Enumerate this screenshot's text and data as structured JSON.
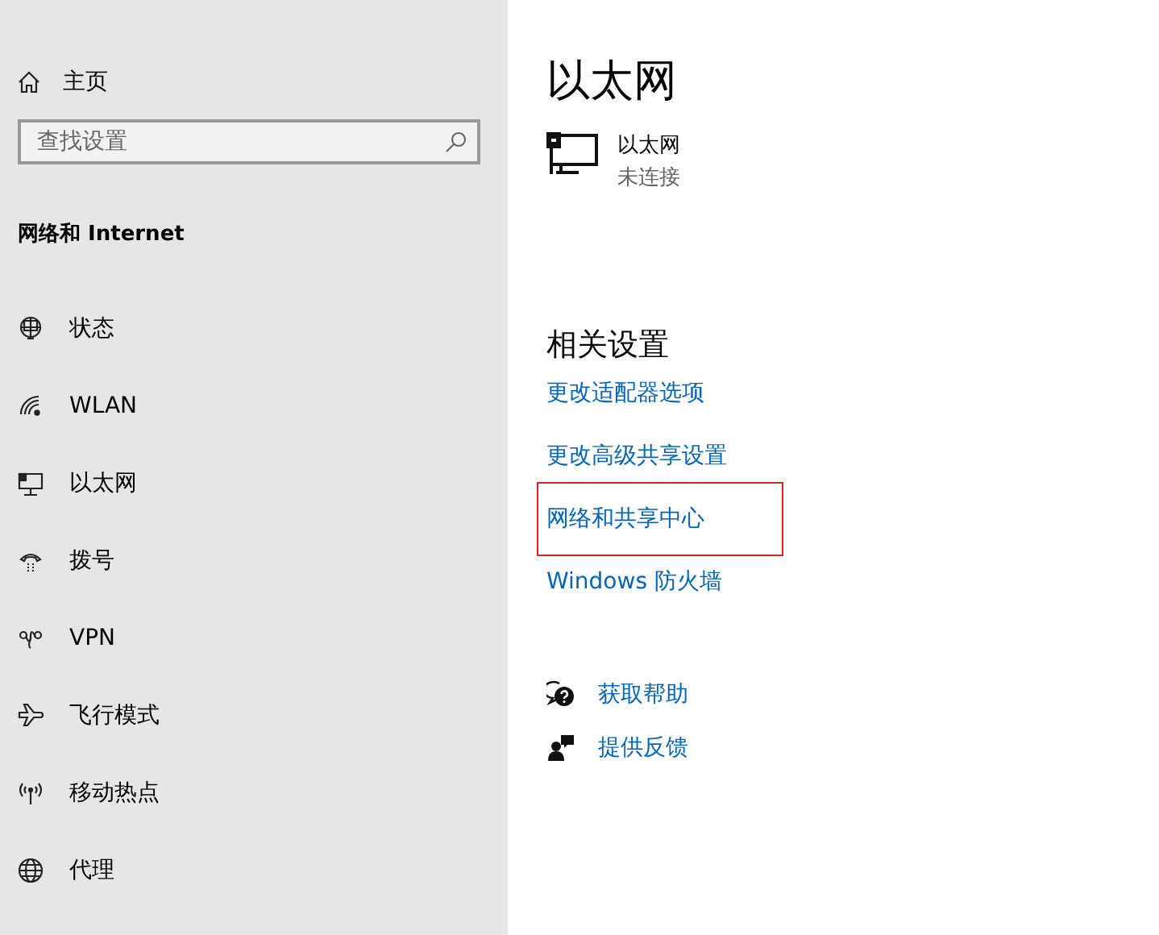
{
  "sidebar": {
    "home": "主页",
    "search": {
      "placeholder": "查找设置"
    },
    "section_title": "网络和 Internet",
    "items": [
      {
        "label": "状态",
        "selected": false
      },
      {
        "label": "WLAN",
        "selected": false
      },
      {
        "label": "以太网",
        "selected": false
      },
      {
        "label": "拨号",
        "selected": false
      },
      {
        "label": "VPN",
        "selected": false
      },
      {
        "label": "飞行模式",
        "selected": false
      },
      {
        "label": "移动热点",
        "selected": false
      },
      {
        "label": "代理",
        "selected": false
      }
    ]
  },
  "main": {
    "title": "以太网",
    "device": {
      "name": "以太网",
      "status": "未连接"
    },
    "related_title": "相关设置",
    "links": [
      {
        "label": "更改适配器选项",
        "highlighted": false
      },
      {
        "label": "更改高级共享设置",
        "highlighted": false
      },
      {
        "label": "网络和共享中心",
        "highlighted": true
      },
      {
        "label": "Windows 防火墙",
        "highlighted": false
      }
    ],
    "help": [
      {
        "label": "获取帮助"
      },
      {
        "label": "提供反馈"
      }
    ]
  }
}
